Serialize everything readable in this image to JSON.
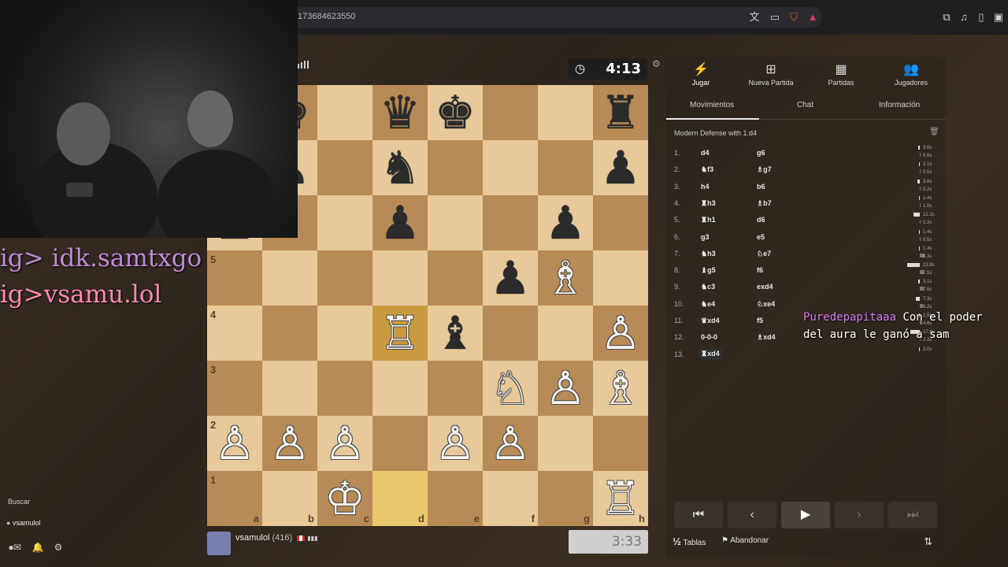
{
  "browser": {
    "url": "173684623550",
    "icons": [
      "translate-icon",
      "cast-icon",
      "brave-shield-icon",
      "brave-rewards-icon",
      "extensions-icon",
      "media-icon",
      "sidebar-icon",
      "wallet-icon"
    ]
  },
  "board": {
    "ranks": [
      "5",
      "4",
      "3",
      "2",
      "1"
    ],
    "files": [
      "a",
      "b",
      "c",
      "d",
      "e",
      "f",
      "g",
      "h"
    ]
  },
  "clock_top": {
    "time": "4:13"
  },
  "player_bottom": {
    "name": "vsamulol",
    "rating": "(416)"
  },
  "clock_bottom": {
    "time": "3:33"
  },
  "nav": [
    {
      "label": "Jugar",
      "icon": "lightning-icon"
    },
    {
      "label": "Nueva Partida",
      "icon": "plus-icon"
    },
    {
      "label": "Partidas",
      "icon": "board-icon"
    },
    {
      "label": "Jugadores",
      "icon": "players-icon"
    }
  ],
  "sub_tabs": [
    "Movimientos",
    "Chat",
    "Información"
  ],
  "opening": "Modern Defense with 1.d4",
  "moves": [
    {
      "num": "1.",
      "w": "d4",
      "b": "g6",
      "wt": "3.0s",
      "bt": "0.6s",
      "wv": 0.13,
      "bv": 0.03
    },
    {
      "num": "2.",
      "w": "♞f3",
      "b": "♗g7",
      "wt": "2.1s",
      "bt": "0.5s",
      "wv": 0.09,
      "bv": 0.02
    },
    {
      "num": "3.",
      "w": "h4",
      "b": "b6",
      "wt": "3.8s",
      "bt": "0.2s",
      "wv": 0.16,
      "bv": 0.01
    },
    {
      "num": "4.",
      "w": "♜h3",
      "b": "♗b7",
      "wt": "1.4s",
      "bt": "1.0s",
      "wv": 0.06,
      "bv": 0.04
    },
    {
      "num": "5.",
      "w": "♜h1",
      "b": "d6",
      "wt": "12.1s",
      "bt": "0.3s",
      "wv": 0.51,
      "bv": 0.01
    },
    {
      "num": "6.",
      "w": "g3",
      "b": "e5",
      "wt": "1.4s",
      "bt": "0.5s",
      "wv": 0.06,
      "bv": 0.02
    },
    {
      "num": "7.",
      "w": "♞h3",
      "b": "♘e7",
      "wt": "1.4s",
      "bt": "8.3s",
      "wv": 0.06,
      "bv": 0.35
    },
    {
      "num": "8.",
      "w": "♝g5",
      "b": "f6",
      "wt": "23.8s",
      "bt": "7.5s",
      "wv": 1.0,
      "bv": 0.32
    },
    {
      "num": "9.",
      "w": "♞c3",
      "b": "exd4",
      "wt": "3.1s",
      "bt": "7.6s",
      "wv": 0.13,
      "bv": 0.32
    },
    {
      "num": "10.",
      "w": "♞e4",
      "b": "♘xe4",
      "wt": "7.3s",
      "bt": "6.2s",
      "wv": 0.31,
      "bv": 0.26
    },
    {
      "num": "11.",
      "w": "♛xd4",
      "b": "f5",
      "wt": "1.5s",
      "bt": "4.6s",
      "wv": 0.06,
      "bv": 0.19
    },
    {
      "num": "12.",
      "w": "0-0-0",
      "b": "♗xd4",
      "wt": "17.6s",
      "bt": "2.2s",
      "wv": 0.74,
      "bv": 0.09
    },
    {
      "num": "13.",
      "w": "♜xd4",
      "b": "",
      "wt": "2.0s",
      "bt": "",
      "wv": 0.08,
      "bv": 0
    }
  ],
  "controls": [
    "first-move-icon",
    "prev-move-icon",
    "play-icon",
    "next-move-icon",
    "last-move-icon"
  ],
  "actions": {
    "draw": "Tablas",
    "draw_symbol": "½",
    "resign": "Abandonar"
  },
  "overlay": {
    "social1": "ig> idk.samtxgo",
    "social2": "ig>vsamu.lol",
    "chat_user": "Puredepapitaaa",
    "chat_text": " Con el poder del aura le ganó a sam"
  },
  "sidebar": {
    "search": "Buscar",
    "user": "vsamulol",
    "notifications": "1"
  },
  "colors": {
    "light_square": "#e7c99a",
    "dark_square": "#b88a55",
    "highlight": "#e8c76e",
    "chat_user": "#d57bf2"
  }
}
